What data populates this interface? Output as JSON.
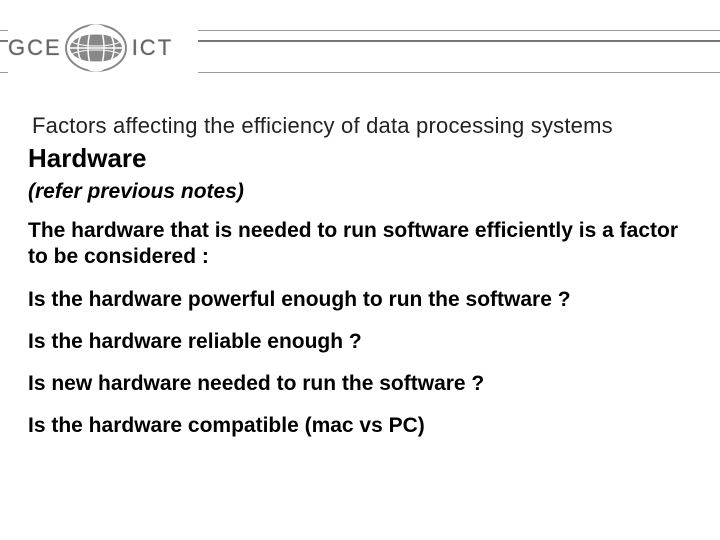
{
  "logo": {
    "left": "GCE",
    "right": "ICT"
  },
  "slide": {
    "title": "Factors affecting the efficiency of data processing systems",
    "section_heading": "Hardware",
    "refer_note": "(refer previous notes)",
    "intro": "The hardware that is needed to run software efficiently is a factor to be considered :",
    "q1": "Is the hardware powerful enough to run the software ?",
    "q2": "Is the hardware reliable enough ?",
    "q3": "Is new hardware needed to run the software ?",
    "q4": "Is the hardware compatible (mac vs PC)"
  }
}
